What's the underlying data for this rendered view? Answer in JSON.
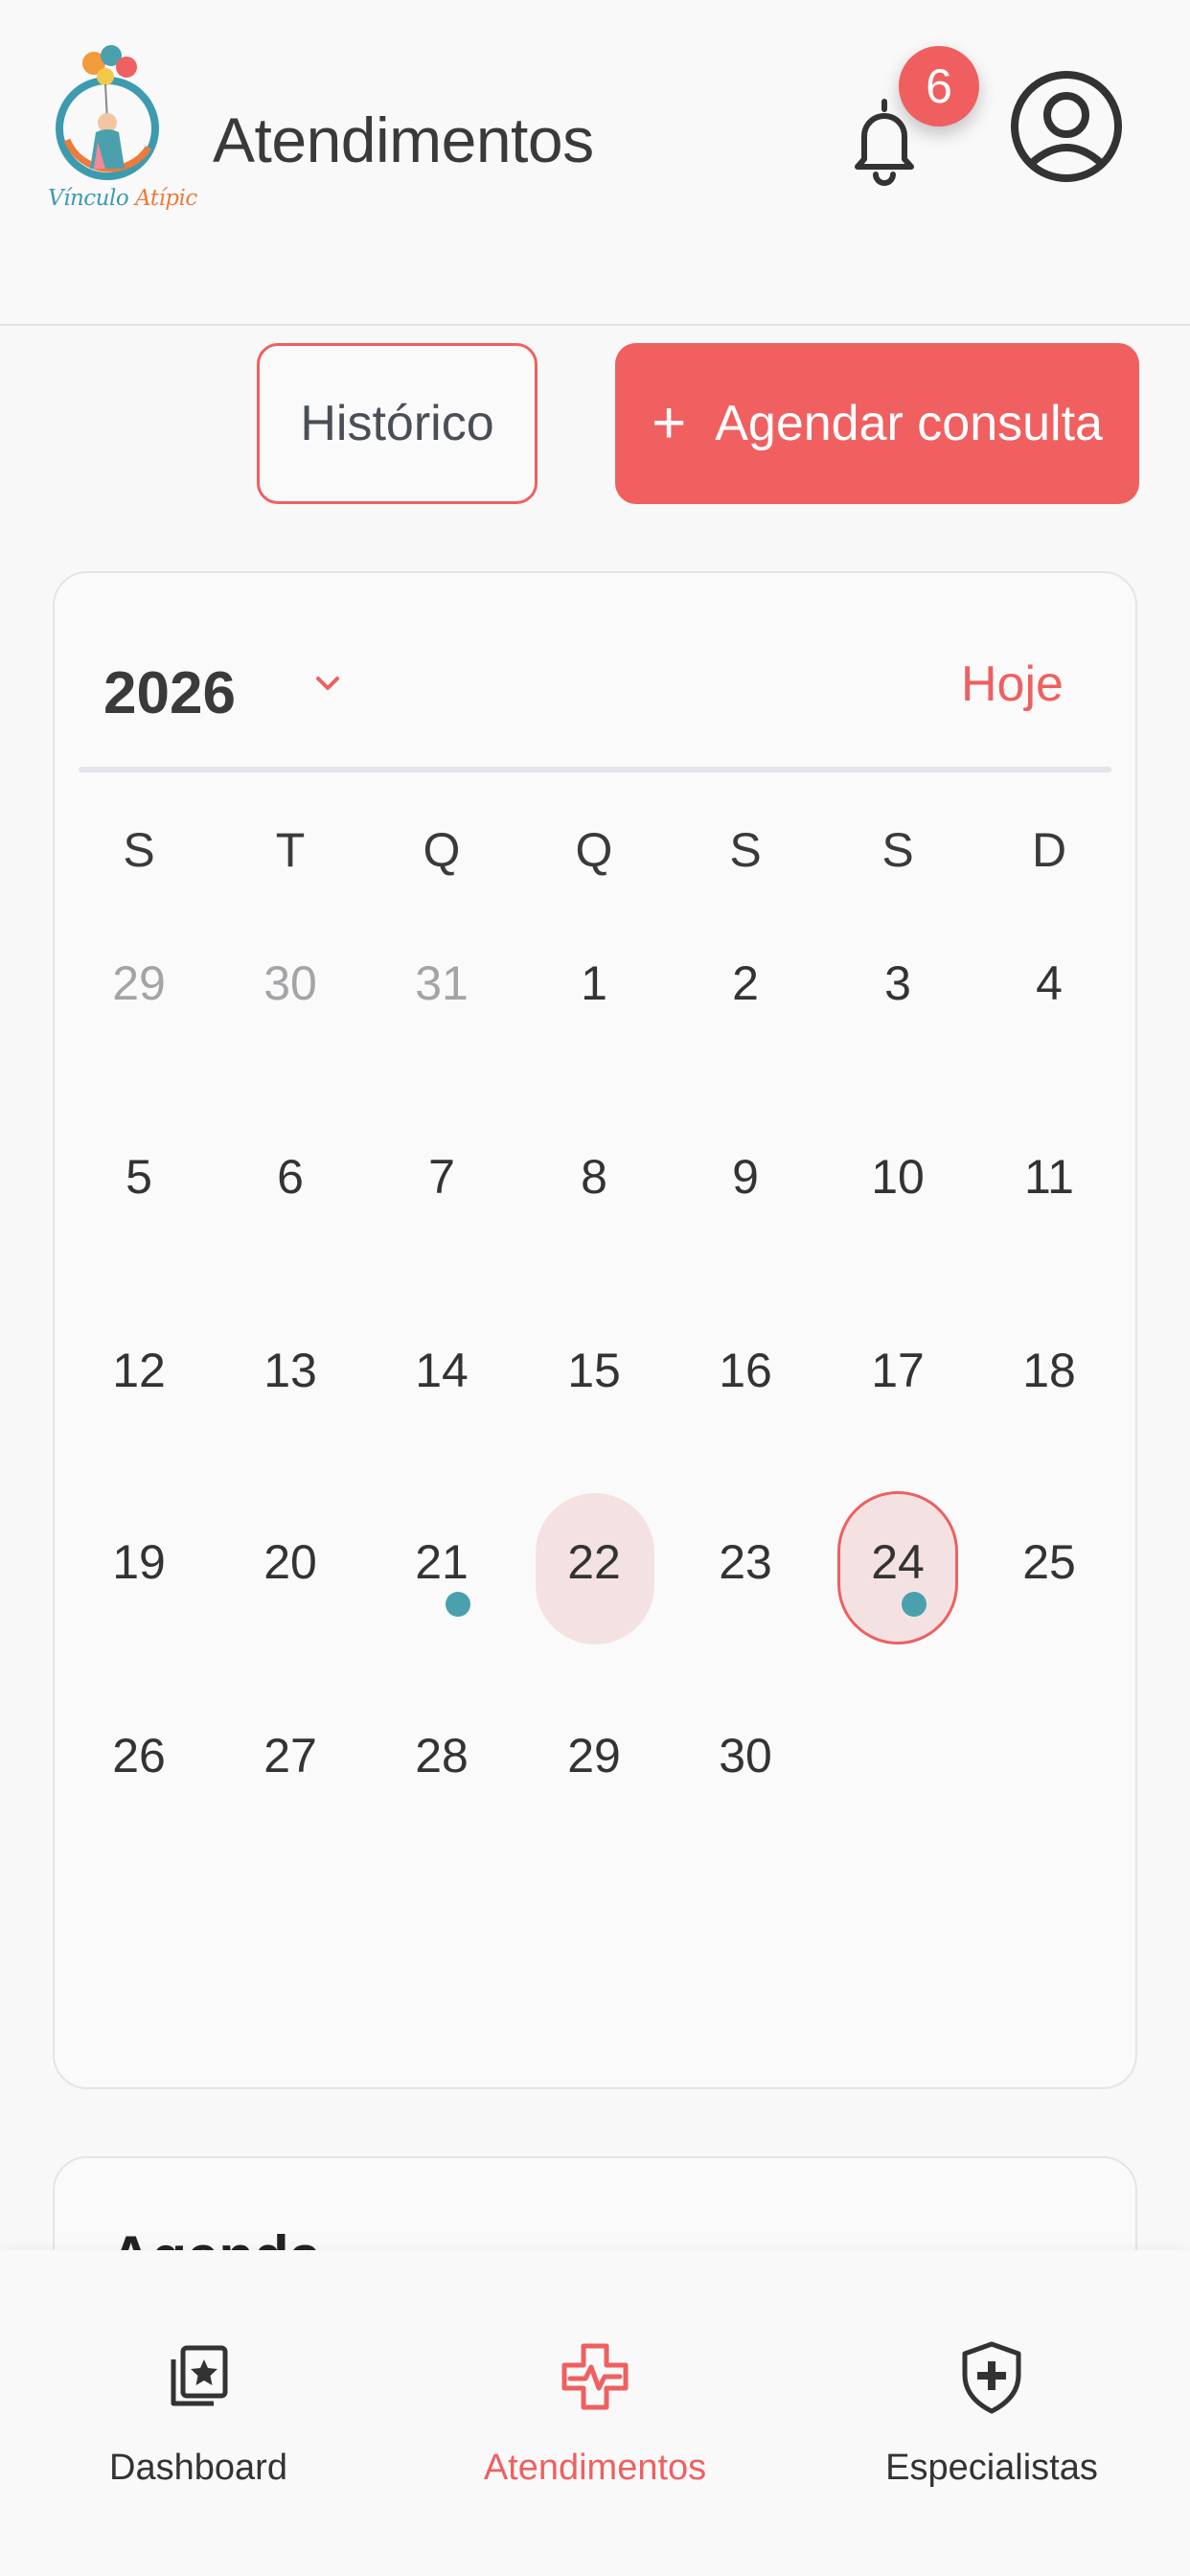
{
  "app": {
    "logo_text_main": "Vínculo ",
    "logo_text_accent": "Atípic",
    "title": "Atendimentos"
  },
  "notifications": {
    "count": "6"
  },
  "actions": {
    "history_label": "Histórico",
    "schedule_label": "Agendar consulta",
    "schedule_icon": "plus-icon"
  },
  "calendar": {
    "year": "2026",
    "today_label": "Hoje",
    "weekdays": [
      "S",
      "T",
      "Q",
      "Q",
      "S",
      "S",
      "D"
    ],
    "weeks": [
      [
        "29",
        "30",
        "31",
        "1",
        "2",
        "3",
        "4"
      ],
      [
        "5",
        "6",
        "7",
        "8",
        "9",
        "10",
        "11"
      ],
      [
        "12",
        "13",
        "14",
        "15",
        "16",
        "17",
        "18"
      ],
      [
        "19",
        "20",
        "21",
        "22",
        "23",
        "24",
        "25"
      ],
      [
        "26",
        "27",
        "28",
        "29",
        "30",
        "",
        ""
      ]
    ],
    "muted_cells": [
      [
        0,
        0
      ],
      [
        0,
        1
      ],
      [
        0,
        2
      ]
    ],
    "today_day": "22",
    "selected_day": "24",
    "event_days": [
      "21",
      "24"
    ],
    "colors": {
      "accent": "#ef6060",
      "event": "#4aa0ad",
      "highlight": "#f4e2e3"
    }
  },
  "agenda": {
    "title": "Agenda"
  },
  "nav": {
    "items": [
      {
        "label": "Dashboard",
        "icon": "dashboard-icon",
        "active": false
      },
      {
        "label": "Atendimentos",
        "icon": "medical-cross-icon",
        "active": true
      },
      {
        "label": "Especialistas",
        "icon": "shield-plus-icon",
        "active": false
      }
    ]
  }
}
